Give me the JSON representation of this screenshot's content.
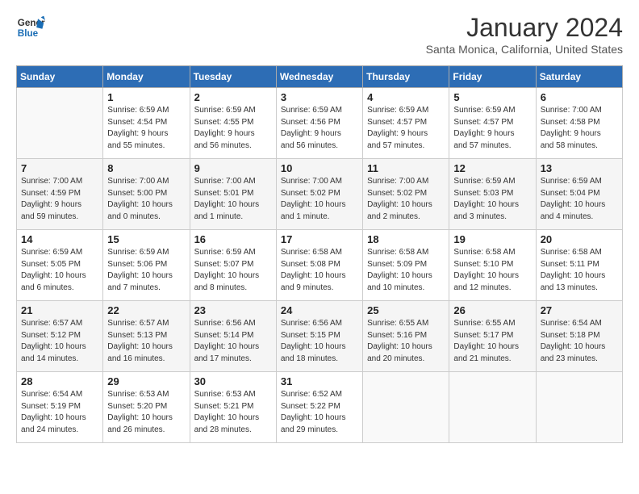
{
  "header": {
    "logo_line1": "General",
    "logo_line2": "Blue",
    "month": "January 2024",
    "location": "Santa Monica, California, United States"
  },
  "weekdays": [
    "Sunday",
    "Monday",
    "Tuesday",
    "Wednesday",
    "Thursday",
    "Friday",
    "Saturday"
  ],
  "weeks": [
    [
      {
        "day": "",
        "info": ""
      },
      {
        "day": "1",
        "info": "Sunrise: 6:59 AM\nSunset: 4:54 PM\nDaylight: 9 hours\nand 55 minutes."
      },
      {
        "day": "2",
        "info": "Sunrise: 6:59 AM\nSunset: 4:55 PM\nDaylight: 9 hours\nand 56 minutes."
      },
      {
        "day": "3",
        "info": "Sunrise: 6:59 AM\nSunset: 4:56 PM\nDaylight: 9 hours\nand 56 minutes."
      },
      {
        "day": "4",
        "info": "Sunrise: 6:59 AM\nSunset: 4:57 PM\nDaylight: 9 hours\nand 57 minutes."
      },
      {
        "day": "5",
        "info": "Sunrise: 6:59 AM\nSunset: 4:57 PM\nDaylight: 9 hours\nand 57 minutes."
      },
      {
        "day": "6",
        "info": "Sunrise: 7:00 AM\nSunset: 4:58 PM\nDaylight: 9 hours\nand 58 minutes."
      }
    ],
    [
      {
        "day": "7",
        "info": "Sunrise: 7:00 AM\nSunset: 4:59 PM\nDaylight: 9 hours\nand 59 minutes."
      },
      {
        "day": "8",
        "info": "Sunrise: 7:00 AM\nSunset: 5:00 PM\nDaylight: 10 hours\nand 0 minutes."
      },
      {
        "day": "9",
        "info": "Sunrise: 7:00 AM\nSunset: 5:01 PM\nDaylight: 10 hours\nand 1 minute."
      },
      {
        "day": "10",
        "info": "Sunrise: 7:00 AM\nSunset: 5:02 PM\nDaylight: 10 hours\nand 1 minute."
      },
      {
        "day": "11",
        "info": "Sunrise: 7:00 AM\nSunset: 5:02 PM\nDaylight: 10 hours\nand 2 minutes."
      },
      {
        "day": "12",
        "info": "Sunrise: 6:59 AM\nSunset: 5:03 PM\nDaylight: 10 hours\nand 3 minutes."
      },
      {
        "day": "13",
        "info": "Sunrise: 6:59 AM\nSunset: 5:04 PM\nDaylight: 10 hours\nand 4 minutes."
      }
    ],
    [
      {
        "day": "14",
        "info": "Sunrise: 6:59 AM\nSunset: 5:05 PM\nDaylight: 10 hours\nand 6 minutes."
      },
      {
        "day": "15",
        "info": "Sunrise: 6:59 AM\nSunset: 5:06 PM\nDaylight: 10 hours\nand 7 minutes."
      },
      {
        "day": "16",
        "info": "Sunrise: 6:59 AM\nSunset: 5:07 PM\nDaylight: 10 hours\nand 8 minutes."
      },
      {
        "day": "17",
        "info": "Sunrise: 6:58 AM\nSunset: 5:08 PM\nDaylight: 10 hours\nand 9 minutes."
      },
      {
        "day": "18",
        "info": "Sunrise: 6:58 AM\nSunset: 5:09 PM\nDaylight: 10 hours\nand 10 minutes."
      },
      {
        "day": "19",
        "info": "Sunrise: 6:58 AM\nSunset: 5:10 PM\nDaylight: 10 hours\nand 12 minutes."
      },
      {
        "day": "20",
        "info": "Sunrise: 6:58 AM\nSunset: 5:11 PM\nDaylight: 10 hours\nand 13 minutes."
      }
    ],
    [
      {
        "day": "21",
        "info": "Sunrise: 6:57 AM\nSunset: 5:12 PM\nDaylight: 10 hours\nand 14 minutes."
      },
      {
        "day": "22",
        "info": "Sunrise: 6:57 AM\nSunset: 5:13 PM\nDaylight: 10 hours\nand 16 minutes."
      },
      {
        "day": "23",
        "info": "Sunrise: 6:56 AM\nSunset: 5:14 PM\nDaylight: 10 hours\nand 17 minutes."
      },
      {
        "day": "24",
        "info": "Sunrise: 6:56 AM\nSunset: 5:15 PM\nDaylight: 10 hours\nand 18 minutes."
      },
      {
        "day": "25",
        "info": "Sunrise: 6:55 AM\nSunset: 5:16 PM\nDaylight: 10 hours\nand 20 minutes."
      },
      {
        "day": "26",
        "info": "Sunrise: 6:55 AM\nSunset: 5:17 PM\nDaylight: 10 hours\nand 21 minutes."
      },
      {
        "day": "27",
        "info": "Sunrise: 6:54 AM\nSunset: 5:18 PM\nDaylight: 10 hours\nand 23 minutes."
      }
    ],
    [
      {
        "day": "28",
        "info": "Sunrise: 6:54 AM\nSunset: 5:19 PM\nDaylight: 10 hours\nand 24 minutes."
      },
      {
        "day": "29",
        "info": "Sunrise: 6:53 AM\nSunset: 5:20 PM\nDaylight: 10 hours\nand 26 minutes."
      },
      {
        "day": "30",
        "info": "Sunrise: 6:53 AM\nSunset: 5:21 PM\nDaylight: 10 hours\nand 28 minutes."
      },
      {
        "day": "31",
        "info": "Sunrise: 6:52 AM\nSunset: 5:22 PM\nDaylight: 10 hours\nand 29 minutes."
      },
      {
        "day": "",
        "info": ""
      },
      {
        "day": "",
        "info": ""
      },
      {
        "day": "",
        "info": ""
      }
    ]
  ]
}
